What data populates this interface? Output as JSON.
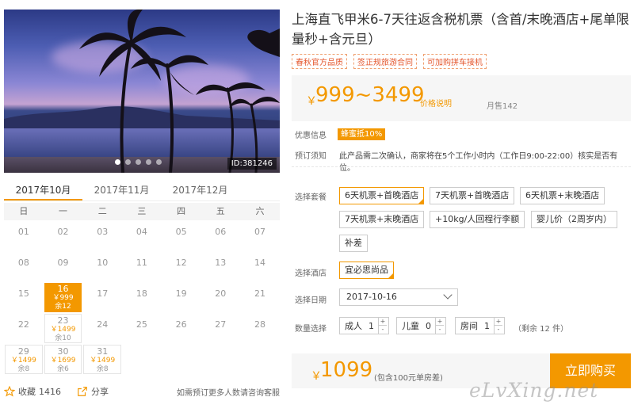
{
  "gallery": {
    "image_id": "ID:381246",
    "slide_count": 5,
    "active_slide": 1
  },
  "calendar": {
    "months": [
      "2017年10月",
      "2017年11月",
      "2017年12月"
    ],
    "active_month": 0,
    "weekdays": [
      "日",
      "一",
      "二",
      "三",
      "四",
      "五",
      "六"
    ],
    "rows": [
      [
        {
          "d": "01"
        },
        {
          "d": "02"
        },
        {
          "d": "03"
        },
        {
          "d": "04"
        },
        {
          "d": "05"
        },
        {
          "d": "06"
        },
        {
          "d": "07"
        }
      ],
      [
        {
          "d": "08"
        },
        {
          "d": "09"
        },
        {
          "d": "10"
        },
        {
          "d": "11"
        },
        {
          "d": "12"
        },
        {
          "d": "13"
        },
        {
          "d": "14"
        }
      ],
      [
        {
          "d": "15"
        },
        {
          "d": "16",
          "p": "￥999",
          "r": "余12",
          "sel": true
        },
        {
          "d": "17"
        },
        {
          "d": "18"
        },
        {
          "d": "19"
        },
        {
          "d": "20"
        },
        {
          "d": "21"
        }
      ],
      [
        {
          "d": "22"
        },
        {
          "d": "23",
          "p": "￥1499",
          "r": "余10"
        },
        {
          "d": "24"
        },
        {
          "d": "25"
        },
        {
          "d": "26"
        },
        {
          "d": "27"
        },
        {
          "d": "28"
        }
      ],
      [
        {
          "d": "29",
          "p": "￥1499",
          "r": "余8"
        },
        {
          "d": "30",
          "p": "￥1699",
          "r": "余6"
        },
        {
          "d": "31",
          "p": "￥1499",
          "r": "余8"
        },
        {
          "d": ""
        },
        {
          "d": ""
        },
        {
          "d": ""
        },
        {
          "d": ""
        }
      ]
    ]
  },
  "footer": {
    "favorite_label": "收藏",
    "favorite_count": "1416",
    "share_label": "分享",
    "hint": "如需预订更多人数请咨询客服"
  },
  "product": {
    "title": "上海直飞甲米6-7天往返含税机票（含首/末晚酒店+尾单限量秒+含元旦）",
    "tags": [
      "春秋官方品质",
      "签正规旅游合同",
      "可加购拼车接机"
    ],
    "price_currency": "￥",
    "price_range": "999~3499",
    "price_note": "价格说明",
    "monthly_sales": "月售142"
  },
  "details": {
    "discount_label": "优惠信息",
    "discount_badge": "蜂蜜抵10%",
    "notice_label": "预订须知",
    "notice_text": "此产品需二次确认，商家将在5个工作小时内（工作日9:00-22:00）核实是否有位。",
    "package_label": "选择套餐",
    "packages": [
      "6天机票+首晚酒店",
      "7天机票+首晚酒店",
      "6天机票+末晚酒店",
      "7天机票+末晚酒店",
      "+10kg/人回程行李额",
      "婴儿价（2周岁内）",
      "补差"
    ],
    "hotel_label": "选择酒店",
    "hotel": "宜必思尚品",
    "date_label": "选择日期",
    "date_value": "2017-10-16",
    "qty_label": "数量选择",
    "adult_label": "成人",
    "adult_value": "1",
    "child_label": "儿童",
    "child_value": "0",
    "room_label": "房间",
    "room_value": "1",
    "remaining": "（剩余 12 件）"
  },
  "purchase": {
    "currency": "￥",
    "total": "1099",
    "total_note": "(包含100元单房差)",
    "buy_label": "立即购买"
  },
  "watermark": "eLvXing.net",
  "colors": {
    "accent": "#f39800",
    "tag_red": "#e4572e"
  }
}
